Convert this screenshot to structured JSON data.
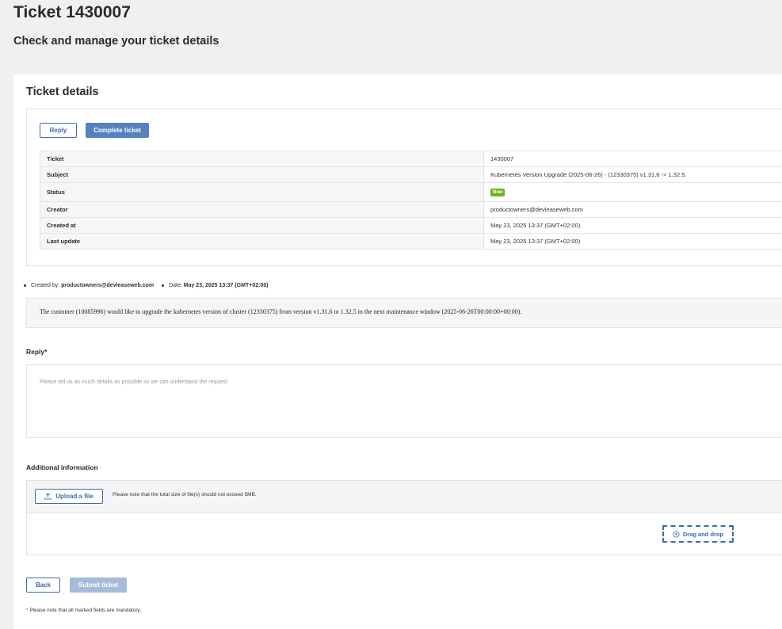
{
  "header": {
    "title": "Ticket 1430007",
    "subtitle": "Check and manage your ticket details"
  },
  "details": {
    "title": "Ticket details",
    "reply_label": "Reply",
    "complete_label": "Complete ticket",
    "rows": [
      {
        "key": "Ticket",
        "value": "1430007"
      },
      {
        "key": "Subject",
        "value": "Kubernetes Version Upgrade (2025-06-26) - (12330375) v1.31.6 -> 1.32.5."
      },
      {
        "key": "Status",
        "value": "New"
      },
      {
        "key": "Creator",
        "value": "productowners@devleaseweb.com"
      },
      {
        "key": "Created at",
        "value": "May 23, 2025 13:37 (GMT+02:00)"
      },
      {
        "key": "Last update",
        "value": "May 23, 2025 13:37 (GMT+02:00)"
      }
    ]
  },
  "message": {
    "created_by_label": "Created by:",
    "created_by": "productowners@devleaseweb.com",
    "date_label": "Date:",
    "date": "May 23, 2025 13:37 (GMT+02:00)",
    "body": "The customer (10085996) would like to upgrade the kubernetes version of cluster (12330375) from version v1.31.6 to 1.32.5 in the next maintenance window (2025-06-26T00:00:00+00:00)."
  },
  "reply": {
    "label": "Reply*",
    "placeholder": "Please tell us as much details as possible so we can understand the request."
  },
  "additional": {
    "label": "Additional information",
    "upload_label": "Upload a file",
    "note": "Please note that the total size of file(s) should not exceed 5MB.",
    "drop_label": "Drag and drop"
  },
  "actions": {
    "back_label": "Back",
    "submit_label": "Submit ticket"
  },
  "footer": {
    "mandatory_star": "*",
    "mandatory_note": "Please note that all marked fields are mandatory."
  },
  "colors": {
    "accent": "#3a6cae",
    "primary_button": "#5582bf",
    "disabled_button": "#a6bbd9",
    "status_new": "#72b21e"
  },
  "icons": {
    "upload": "upload-icon",
    "drop": "cloud-upload-icon"
  }
}
